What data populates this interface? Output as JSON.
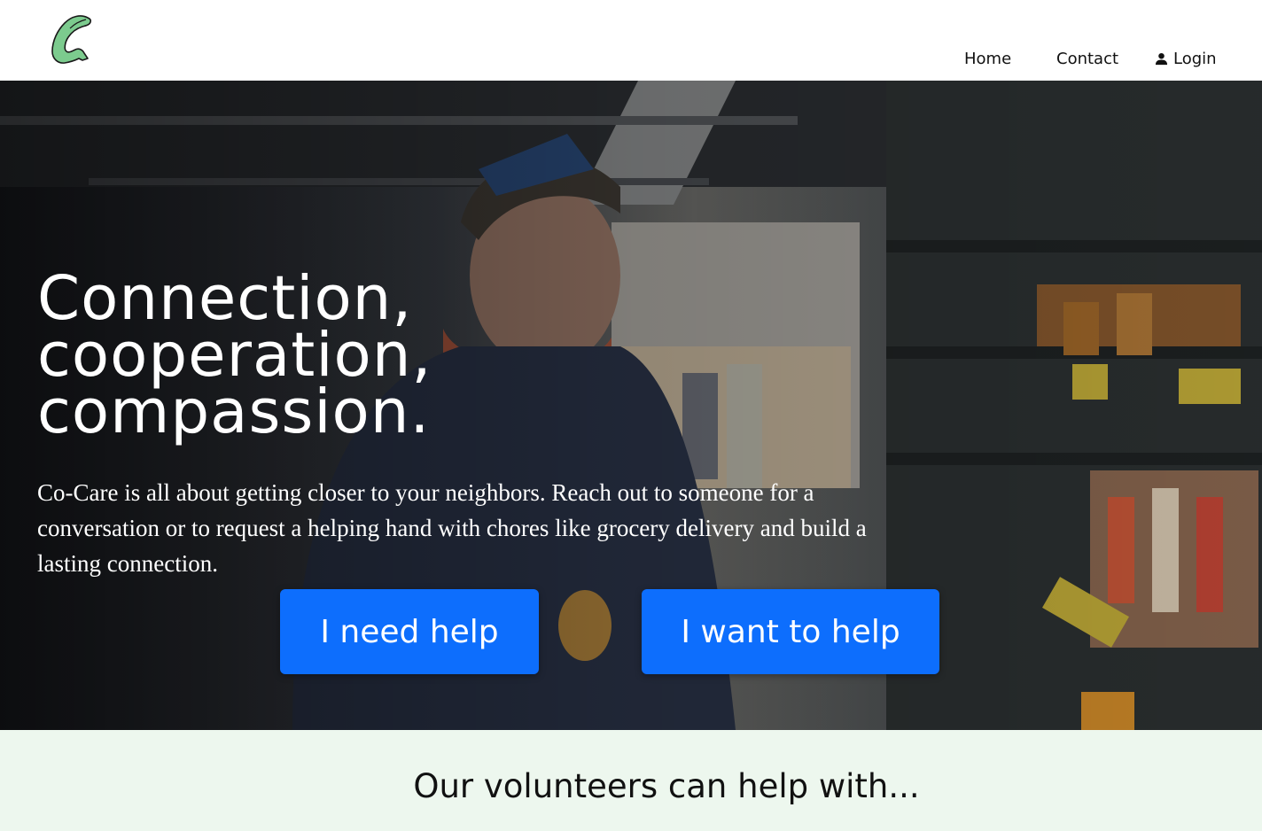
{
  "nav": {
    "home": "Home",
    "contact": "Contact",
    "login": "Login"
  },
  "hero": {
    "title_lines": [
      "Connection,",
      "cooperation,",
      "compassion."
    ],
    "description": "Co-Care is all about getting closer to your neighbors. Reach out to someone for a conversation or to request a helping hand with chores like grocery delivery and build a lasting connection.",
    "need_help_label": "I need help",
    "want_to_help_label": "I want to help"
  },
  "services": {
    "title": "Our volunteers can help with..."
  },
  "icons": {
    "logo": "co-care-hand-logo",
    "login": "user-icon"
  },
  "colors": {
    "primary_button": "#0d6efd",
    "services_background": "#edf7ee",
    "logo_green": "#7ccb8e"
  }
}
